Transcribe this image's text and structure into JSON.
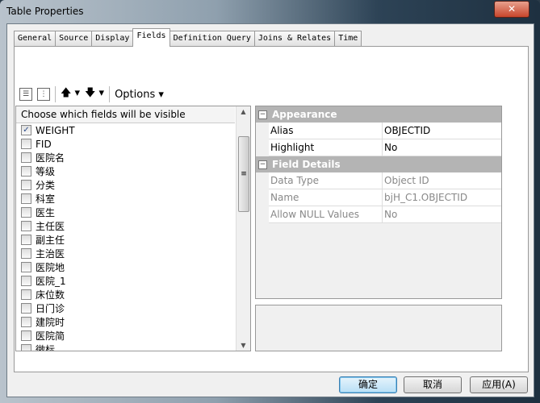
{
  "window": {
    "title": "Table Properties",
    "close_label": "✕"
  },
  "tabs": [
    {
      "label": "General"
    },
    {
      "label": "Source"
    },
    {
      "label": "Display"
    },
    {
      "label": "Fields",
      "active": true
    },
    {
      "label": "Definition Query"
    },
    {
      "label": "Joins & Relates"
    },
    {
      "label": "Time"
    }
  ],
  "toolbar": {
    "options_label": "Options ▾",
    "up_label": "🡅 ▾",
    "down_label": "🡇 ▾"
  },
  "fields_list": {
    "header": "Choose which fields will be visible",
    "items": [
      {
        "label": "WEIGHT",
        "checked": true
      },
      {
        "label": "FID"
      },
      {
        "label": "医院名"
      },
      {
        "label": "等级"
      },
      {
        "label": "分类"
      },
      {
        "label": "科室"
      },
      {
        "label": "医生"
      },
      {
        "label": "主任医"
      },
      {
        "label": "副主任"
      },
      {
        "label": "主治医"
      },
      {
        "label": "医院地"
      },
      {
        "label": "医院_1"
      },
      {
        "label": "床位数"
      },
      {
        "label": "日门诊"
      },
      {
        "label": "建院时"
      },
      {
        "label": "医院简"
      },
      {
        "label": "微标"
      }
    ]
  },
  "properties": {
    "appearance": {
      "title": "Appearance",
      "rows": [
        {
          "key": "Alias",
          "value": "OBJECTID"
        },
        {
          "key": "Highlight",
          "value": "No"
        }
      ]
    },
    "field_details": {
      "title": "Field Details",
      "rows": [
        {
          "key": "Data Type",
          "value": "Object ID"
        },
        {
          "key": "Name",
          "value": "bjH_C1.OBJECTID"
        },
        {
          "key": "Allow NULL Values",
          "value": "No"
        }
      ]
    }
  },
  "buttons": {
    "ok": "确定",
    "cancel": "取消",
    "apply": "应用(A)"
  }
}
